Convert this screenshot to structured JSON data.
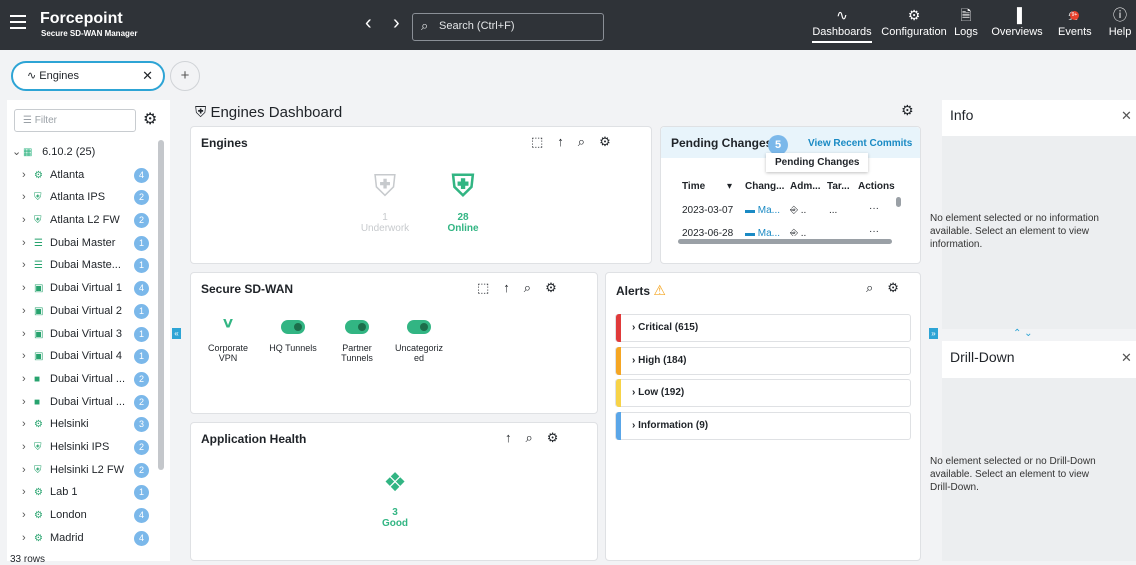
{
  "topbar": {
    "brand": "Forcepoint",
    "product": "Secure SD-WAN Manager",
    "search_placeholder": "Search (Ctrl+F)",
    "nav": [
      {
        "label": "Dashboards",
        "icon": "pulse-icon"
      },
      {
        "label": "Configuration",
        "icon": "gear-icon"
      },
      {
        "label": "Logs",
        "icon": "document-icon"
      },
      {
        "label": "Overviews",
        "icon": "bar-chart-icon"
      },
      {
        "label": "Events",
        "icon": "bell-icon"
      },
      {
        "label": "Help",
        "icon": "help-icon"
      }
    ],
    "events_badge": "9+"
  },
  "tabs": {
    "active": "Engines",
    "add": "+"
  },
  "sidebar": {
    "filter_placeholder": "Filter",
    "root": {
      "label": "6.10.2 (25)"
    },
    "items": [
      {
        "label": "Atlanta",
        "count": "4"
      },
      {
        "label": "Atlanta IPS",
        "count": "2"
      },
      {
        "label": "Atlanta L2 FW",
        "count": "2"
      },
      {
        "label": "Dubai Master",
        "count": "1"
      },
      {
        "label": "Dubai Maste...",
        "count": "1"
      },
      {
        "label": "Dubai Virtual 1",
        "count": "4"
      },
      {
        "label": "Dubai Virtual 2",
        "count": "1"
      },
      {
        "label": "Dubai Virtual 3",
        "count": "1"
      },
      {
        "label": "Dubai Virtual 4",
        "count": "1"
      },
      {
        "label": "Dubai Virtual ...",
        "count": "2"
      },
      {
        "label": "Dubai Virtual ...",
        "count": "2"
      },
      {
        "label": "Helsinki",
        "count": "3"
      },
      {
        "label": "Helsinki IPS",
        "count": "2"
      },
      {
        "label": "Helsinki L2 FW",
        "count": "2"
      },
      {
        "label": "Lab 1",
        "count": "1"
      },
      {
        "label": "London",
        "count": "4"
      },
      {
        "label": "Madrid",
        "count": "4"
      }
    ],
    "row_count": "33 rows"
  },
  "dashboard": {
    "title": "Engines Dashboard"
  },
  "engines": {
    "title": "Engines",
    "underwork": {
      "count": "1",
      "label": "Underwork"
    },
    "online": {
      "count": "28",
      "label": "Online"
    }
  },
  "pending": {
    "title": "Pending Changes",
    "count": "5",
    "link": "View Recent Commits",
    "tooltip": "Pending Changes",
    "headers": [
      "Time",
      "Chang...",
      "Adm...",
      "Tar...",
      "Actions"
    ],
    "rows": [
      {
        "time": "2023-03-07",
        "change": "Ma...",
        "admin": "..",
        "target": "...",
        "actions": "···"
      },
      {
        "time": "2023-06-28",
        "change": "Ma...",
        "admin": "..",
        "target": "...",
        "actions": "···"
      }
    ]
  },
  "sdwan": {
    "title": "Secure SD-WAN",
    "items": [
      {
        "label1": "Corporate",
        "label2": "VPN"
      },
      {
        "label1": "HQ Tunnels",
        "label2": ""
      },
      {
        "label1": "Partner",
        "label2": "Tunnels"
      },
      {
        "label1": "Uncategoriz",
        "label2": "ed"
      }
    ]
  },
  "alerts": {
    "title": "Alerts",
    "rows": [
      {
        "label": "Critical (615)",
        "color": "#e03a3a"
      },
      {
        "label": "High (184)",
        "color": "#f5a623"
      },
      {
        "label": "Low (192)",
        "color": "#f7d348"
      },
      {
        "label": "Information (9)",
        "color": "#5aa6e8"
      }
    ]
  },
  "apphealth": {
    "title": "Application Health",
    "count": "3",
    "label": "Good"
  },
  "info": {
    "title": "Info",
    "message": "No element selected or no information available. Select an element to view information."
  },
  "drilldown": {
    "title": "Drill-Down",
    "message": "No element selected or no Drill-Down available. Select an element to view Drill-Down."
  },
  "colors": {
    "accent": "#2da4d5",
    "good": "#32b583",
    "topbar": "#2f3338"
  }
}
